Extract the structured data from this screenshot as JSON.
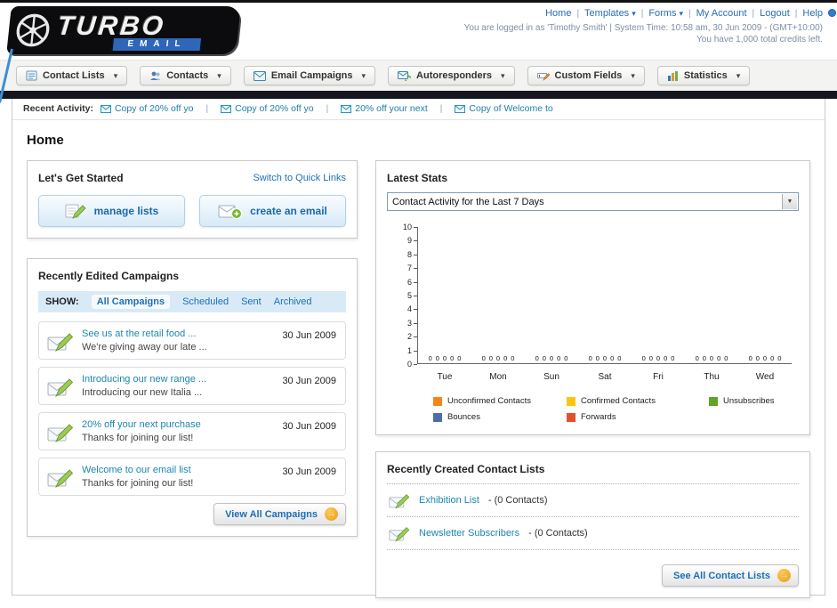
{
  "header": {
    "logo_primary": "TURBO",
    "logo_secondary": "EMAIL",
    "links": [
      "Home",
      "Templates",
      "Forms",
      "My Account",
      "Logout",
      "Help"
    ],
    "status_line": "You are logged in as 'Timothy Smith' | System Time: 10:58 am, 30 Jun 2009 - (GMT+10:00)",
    "credits_line": "You have 1,000 total credits left."
  },
  "main_nav": {
    "items": [
      {
        "label": "Contact Lists"
      },
      {
        "label": "Contacts"
      },
      {
        "label": "Email Campaigns"
      },
      {
        "label": "Autoresponders"
      },
      {
        "label": "Custom Fields"
      },
      {
        "label": "Statistics"
      }
    ]
  },
  "recent_activity": {
    "label": "Recent Activity:",
    "items": [
      "Copy of 20% off yo",
      "Copy of 20% off yo",
      "20% off your next",
      "Copy of Welcome to"
    ]
  },
  "page": {
    "title": "Home"
  },
  "get_started": {
    "title": "Let's Get Started",
    "switch_link": "Switch to Quick Links",
    "buttons": [
      {
        "label": "manage lists"
      },
      {
        "label": "create an email"
      }
    ]
  },
  "campaigns": {
    "title": "Recently Edited Campaigns",
    "show_label": "SHOW:",
    "tabs": [
      "All Campaigns",
      "Scheduled",
      "Sent",
      "Archived"
    ],
    "selected_tab": "All Campaigns",
    "items": [
      {
        "title": "See us at the retail food ...",
        "subtitle": "We're giving away our late ...",
        "date": "30 Jun 2009"
      },
      {
        "title": "Introducing our new range ...",
        "subtitle": "Introducing our new Italia ...",
        "date": "30 Jun 2009"
      },
      {
        "title": "20% off your next purchase",
        "subtitle": "Thanks for joining our list!",
        "date": "30 Jun 2009"
      },
      {
        "title": "Welcome to our email list",
        "subtitle": "Thanks for joining our list!",
        "date": "30 Jun 2009"
      }
    ],
    "view_all_label": "View All Campaigns"
  },
  "stats": {
    "title": "Latest Stats",
    "dropdown_value": "Contact Activity for the Last 7 Days"
  },
  "chart_data": {
    "type": "bar",
    "title": "Contact Activity for the Last 7 Days",
    "categories": [
      "Tue",
      "Mon",
      "Sun",
      "Sat",
      "Fri",
      "Thu",
      "Wed"
    ],
    "series": [
      {
        "name": "Unconfirmed Contacts",
        "color": "#f28718",
        "values": [
          0,
          0,
          0,
          0,
          0,
          0,
          0
        ]
      },
      {
        "name": "Confirmed Contacts",
        "color": "#fdc513",
        "values": [
          0,
          0,
          0,
          0,
          0,
          0,
          0
        ]
      },
      {
        "name": "Unsubscribes",
        "color": "#61a525",
        "values": [
          0,
          0,
          0,
          0,
          0,
          0,
          0
        ]
      },
      {
        "name": "Bounces",
        "color": "#4f6da5",
        "values": [
          0,
          0,
          0,
          0,
          0,
          0,
          0
        ]
      },
      {
        "name": "Forwards",
        "color": "#e4502e",
        "values": [
          0,
          0,
          0,
          0,
          0,
          0,
          0
        ]
      }
    ],
    "xlabel": "",
    "ylabel": "",
    "ylim": [
      0,
      10
    ],
    "yticks": [
      0,
      1,
      2,
      3,
      4,
      5,
      6,
      7,
      8,
      9,
      10
    ],
    "grid": false,
    "legend_position": "bottom"
  },
  "contact_lists": {
    "title": "Recently Created Contact Lists",
    "items": [
      {
        "name": "Exhibition List",
        "suffix": "- (0 Contacts)"
      },
      {
        "name": "Newsletter Subscribers",
        "suffix": "- (0 Contacts)"
      }
    ],
    "see_all_label": "See All Contact Lists"
  },
  "icons": {
    "dropdown_caret": "▾",
    "go_arrow": "→",
    "accent_orange": "#f09a16",
    "link_blue": "#1d6fb8",
    "teal_link": "#1b87b0"
  }
}
